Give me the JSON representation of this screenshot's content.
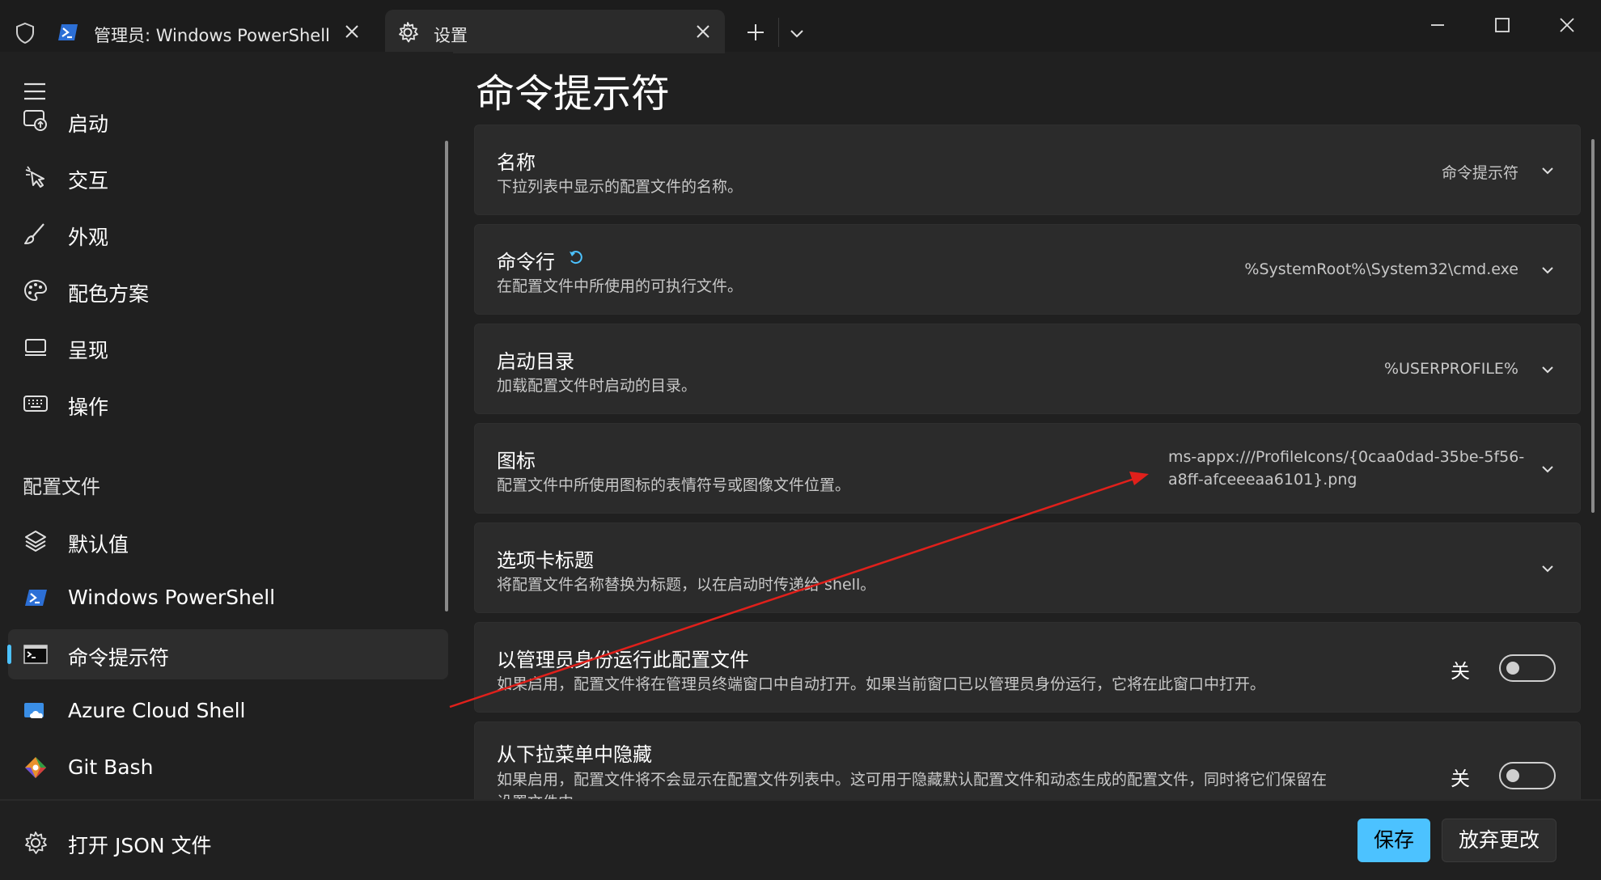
{
  "titlebar": {
    "tabs": [
      {
        "label": "管理员: Windows PowerShell",
        "icon": "powershell-icon",
        "active": false
      },
      {
        "label": "设置",
        "icon": "gear-icon",
        "active": true
      }
    ]
  },
  "nav": {
    "items": [
      {
        "label": "启动",
        "icon": "startup-icon"
      },
      {
        "label": "交互",
        "icon": "interaction-icon"
      },
      {
        "label": "外观",
        "icon": "brush-icon"
      },
      {
        "label": "配色方案",
        "icon": "palette-icon"
      },
      {
        "label": "呈现",
        "icon": "monitor-icon"
      },
      {
        "label": "操作",
        "icon": "keyboard-icon"
      }
    ],
    "section_label": "配置文件",
    "profiles": [
      {
        "label": "默认值",
        "icon": "layers-icon"
      },
      {
        "label": "Windows PowerShell",
        "icon": "powershell-icon"
      },
      {
        "label": "命令提示符",
        "icon": "cmd-icon",
        "selected": true
      },
      {
        "label": "Azure Cloud Shell",
        "icon": "azure-icon"
      },
      {
        "label": "Git Bash",
        "icon": "git-icon"
      }
    ]
  },
  "bottom": {
    "open_json_label": "打开 JSON 文件",
    "save_label": "保存",
    "discard_label": "放弃更改"
  },
  "main": {
    "title": "命令提示符",
    "settings": [
      {
        "title": "名称",
        "description": "下拉列表中显示的配置文件的名称。",
        "value": "命令提示符"
      },
      {
        "title": "命令行",
        "description": "在配置文件中所使用的可执行文件。",
        "value": "%SystemRoot%\\System32\\cmd.exe",
        "has_reset": true
      },
      {
        "title": "启动目录",
        "description": "加载配置文件时启动的目录。",
        "value": "%USERPROFILE%"
      },
      {
        "title": "图标",
        "description": "配置文件中所使用图标的表情符号或图像文件位置。",
        "value_line1": "ms-appx:///ProfileIcons/{0caa0dad-35be-5f56-",
        "value_line2": "a8ff-afceeeaa6101}.png"
      },
      {
        "title": "选项卡标题",
        "description": "将配置文件名称替换为标题，以在启动时传递给 shell。",
        "value": ""
      },
      {
        "title": "以管理员身份运行此配置文件",
        "description": "如果启用，配置文件将在管理员终端窗口中自动打开。如果当前窗口已以管理员身份运行，它将在此窗口中打开。",
        "toggle_label": "关",
        "toggle_on": false
      },
      {
        "title": "从下拉菜单中隐藏",
        "description_line1": "如果启用，配置文件将不会显示在配置文件列表中。这可用于隐藏默认配置文件和动态生成的配置文件，同时将它们保留在",
        "description_line2": "设置文件中。",
        "toggle_label": "关",
        "toggle_on": false
      }
    ]
  },
  "colors": {
    "accent": "#4cc2ff",
    "annotation_arrow": "#e0201b",
    "background": "#202020",
    "card": "#2b2b2b"
  }
}
